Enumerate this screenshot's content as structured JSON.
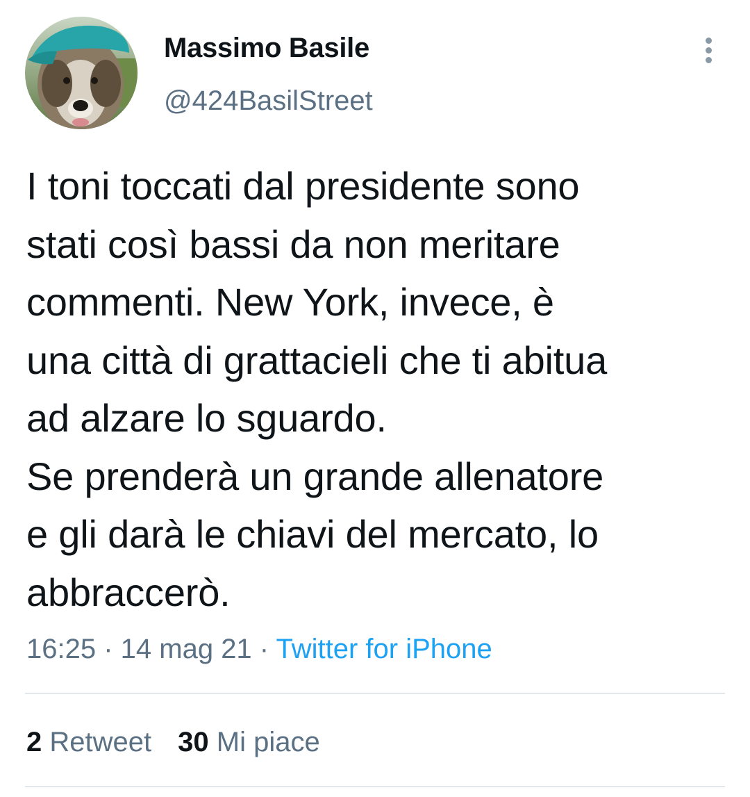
{
  "author": {
    "name": "Massimo Basile",
    "handle": "@424BasilStreet",
    "avatar_icon": "dog-with-teal-cap-avatar"
  },
  "tweet": {
    "text": "I toni toccati dal presidente sono\nstati così bassi da non meritare\ncommenti. New York, invece, è\nuna città di grattacieli che ti abitua\nad alzare lo sguardo.\nSe prenderà un grande allenatore\ne gli darà le chiavi del mercato, lo\nabbraccerò.",
    "time": "16:25",
    "separator": " · ",
    "date": "14 mag 21",
    "source": "Twitter for iPhone"
  },
  "stats": {
    "retweets_count": "2",
    "retweets_label": "Retweet",
    "likes_count": "30",
    "likes_label": "Mi piace"
  },
  "icons": {
    "more": "more-vertical-icon"
  },
  "colors": {
    "text": "#0f1419",
    "secondary": "#5b7083",
    "link": "#1da1f2",
    "divider": "#e1e8ed"
  }
}
